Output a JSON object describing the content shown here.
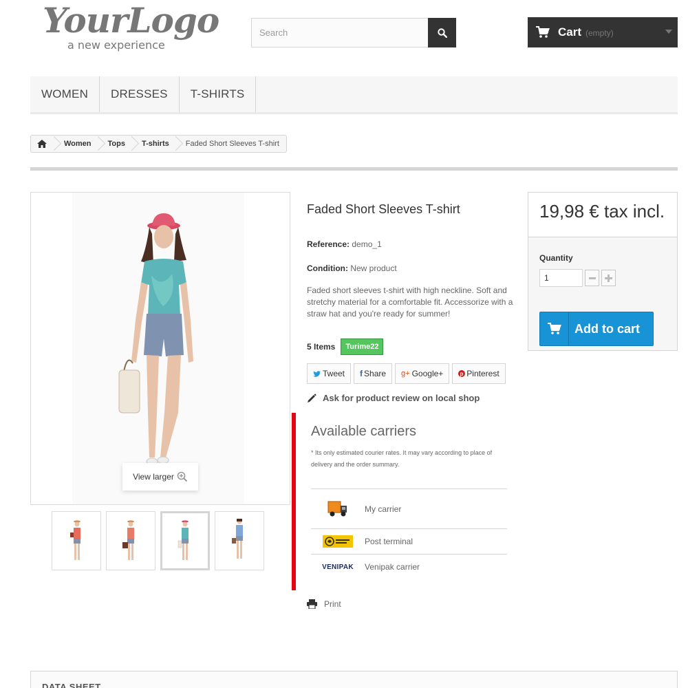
{
  "header": {
    "logo_main": "YourLogo",
    "logo_tagline": "a new experience",
    "search_placeholder": "Search",
    "cart_title": "Cart",
    "cart_status": "(empty)"
  },
  "nav": {
    "items": [
      {
        "label": "WOMEN"
      },
      {
        "label": "DRESSES"
      },
      {
        "label": "T-SHIRTS"
      }
    ]
  },
  "breadcrumb": {
    "items": [
      "Women",
      "Tops",
      "T-shirts"
    ],
    "current": "Faded Short Sleeves T-shirt"
  },
  "product": {
    "image_action": "View larger",
    "title": "Faded Short Sleeves T-shirt",
    "reference_label": "Reference:",
    "reference_value": "demo_1",
    "condition_label": "Condition:",
    "condition_value": "New product",
    "description": "Faded short sleeves t-shirt with high neckline. Soft and stretchy material for a comfortable fit. Accessorize with a straw hat and you're ready for summer!",
    "stock_qty": "5 Items",
    "stock_badge": "Turime22"
  },
  "social": {
    "tweet": "Tweet",
    "share": "Share",
    "google": "Google+",
    "pinterest": "Pinterest"
  },
  "review_link": "Ask for product review on local shop",
  "carriers": {
    "title": "Available carriers",
    "note": "* Its only estimated courier rates. It may vary according to place of delivery and the order summary.",
    "rows": [
      {
        "name": "My carrier",
        "logo": "truck-icon"
      },
      {
        "name": "Post terminal",
        "logo": "post-logo"
      },
      {
        "name": "Venipak carrier",
        "logo": "venipak-logo",
        "logo_text": "VENIPAK"
      }
    ]
  },
  "print_label": "Print",
  "buy_box": {
    "price": "19,98 € tax incl.",
    "quantity_label": "Quantity",
    "quantity_value": "1",
    "add_to_cart": "Add to cart"
  },
  "datasheet_title": "DATA SHEET",
  "colors": {
    "accent_blue": "#1893d6",
    "stock_green": "#55c65e",
    "marker_red": "#e30613",
    "dark": "#333333"
  }
}
